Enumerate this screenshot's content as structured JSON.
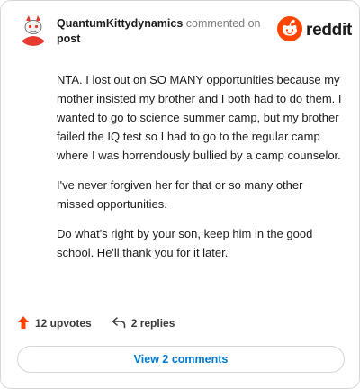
{
  "comment": {
    "author": "QuantumKittydynamics",
    "action_text": "commented on",
    "target_link": "post",
    "paragraphs": [
      "NTA. I lost out on SO MANY opportunities because my mother insisted my brother and I both had to do them. I wanted to go to science summer camp, but my brother failed the IQ test so I had to go to the regular camp where I was horrendously bullied by a camp counselor.",
      "I've never forgiven her for that or so many other missed opportunities.",
      "Do what's right by your son, keep him in the good school. He'll thank you for it later."
    ],
    "upvotes_label": "12 upvotes",
    "replies_label": "2 replies",
    "view_comments_label": "View 2 comments"
  },
  "brand": {
    "wordmark": "reddit",
    "accent": "#ff4500"
  },
  "colors": {
    "upvote": "#ff4500",
    "link": "#0079d3",
    "muted": "#7c7c7c"
  },
  "icons": {
    "avatar": "snoo-avatar-icon",
    "logo": "reddit-logo-icon",
    "upvote": "upvote-arrow-icon",
    "reply": "reply-arrow-icon"
  }
}
